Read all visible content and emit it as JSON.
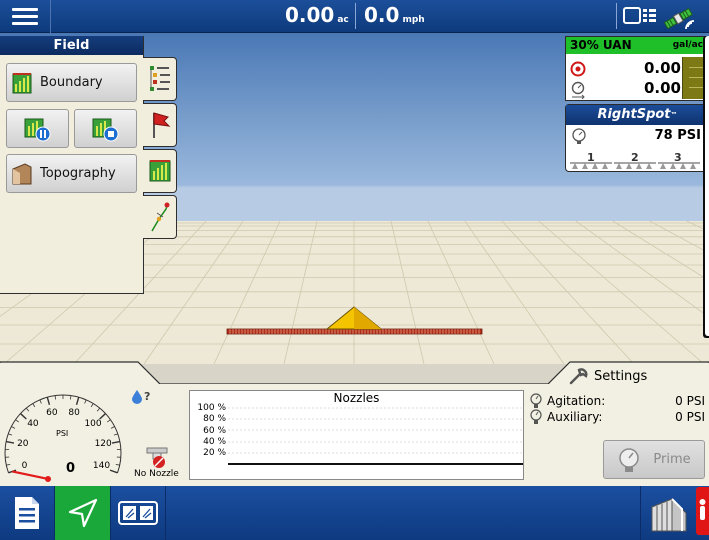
{
  "topbar": {
    "area_value": "0.00",
    "area_unit": "ac",
    "speed_value": "0.0",
    "speed_unit": "mph",
    "icons": [
      "menu-icon",
      "display-toggle-icon",
      "satellite-gps-icon"
    ]
  },
  "field_panel": {
    "title": "Field",
    "boundary_label": "Boundary",
    "topography_label": "Topography",
    "side_tabs": [
      "layers-tab",
      "flag-tab",
      "field-tab",
      "guidance-tab"
    ]
  },
  "product": {
    "name": "30% UAN",
    "unit": "gal/ac",
    "target_rate": "0.00",
    "applied_rate": "0.00",
    "accent": "#1fbf2a"
  },
  "rightspot": {
    "title": "RightSpot",
    "tm": "™",
    "pressure": "78 PSI",
    "sections": [
      "1",
      "2",
      "3"
    ]
  },
  "gauge": {
    "unit": "PSI",
    "value": "0",
    "ticks": [
      "0",
      "20",
      "40",
      "60",
      "80",
      "100",
      "120",
      "140"
    ],
    "max": 140,
    "needle_value": 0
  },
  "nozzle_status": "No Nozzle",
  "nozzles_chart": {
    "title": "Nozzles",
    "y_ticks": [
      "100 %",
      "80 %",
      "60 %",
      "40 %",
      "20 %"
    ]
  },
  "settings": {
    "label": "Settings",
    "agitation_label": "Agitation:",
    "agitation_value": "0 PSI",
    "auxiliary_label": "Auxiliary:",
    "auxiliary_value": "0 PSI",
    "prime_label": "Prime"
  },
  "bottombar": {
    "buttons": [
      "document-icon",
      "navigation-icon",
      "split-screen-icon",
      "implement-icon"
    ],
    "active_color": "#1aa83a"
  }
}
